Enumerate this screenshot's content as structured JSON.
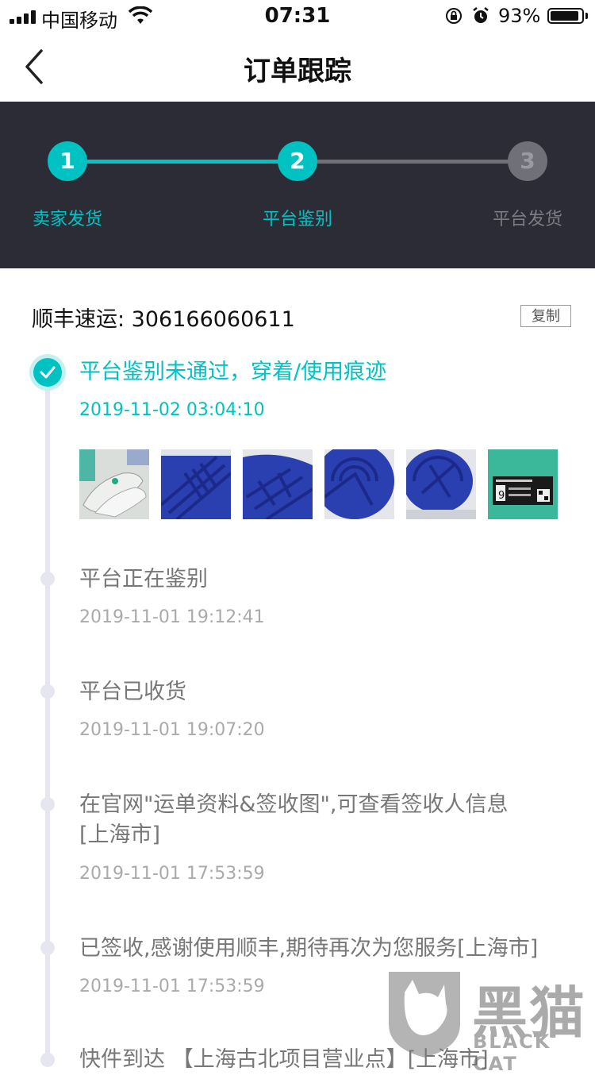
{
  "status_bar": {
    "carrier": "中国移动",
    "time": "07:31",
    "battery_percent": "93%",
    "battery_level": 0.93,
    "icons": [
      "signal-icon",
      "wifi-icon",
      "rotation-lock-icon",
      "alarm-icon",
      "battery-icon"
    ]
  },
  "nav": {
    "title": "订单跟踪",
    "back_icon": "chevron-left-icon"
  },
  "progress": {
    "steps": [
      {
        "number": "1",
        "label": "卖家发货",
        "state": "done"
      },
      {
        "number": "2",
        "label": "平台鉴别",
        "state": "current"
      },
      {
        "number": "3",
        "label": "平台发货",
        "state": "pending"
      }
    ],
    "colors": {
      "active": "#01c2c3",
      "inactive": "#6f7078",
      "background": "#2b2c36"
    }
  },
  "tracking": {
    "carrier_number": "顺丰速运: 306166060611",
    "copy_label": "复制"
  },
  "events": [
    {
      "text": "平台鉴别未通过，穿着/使用痕迹",
      "time": "2019-11-02 03:04:10",
      "highlight": true
    },
    {
      "text": "平台正在鉴别",
      "time": "2019-11-01 19:12:41"
    },
    {
      "text": "平台已收货",
      "time": "2019-11-01 19:07:20"
    },
    {
      "text": "在官网\"运单资料&签收图\",可查看签收人信息[上海市]",
      "time": "2019-11-01 17:53:59"
    },
    {
      "text": "已签收,感谢使用顺丰,期待再次为您服务[上海市]",
      "time": "2019-11-01 17:53:59"
    },
    {
      "text": "快件到达 【上海古北项目营业点】[上海市]",
      "time": ""
    }
  ],
  "photos": {
    "count": 6,
    "box_label_number": "9"
  },
  "watermark": {
    "cn": "黑猫",
    "en": "BLACK CAT"
  }
}
